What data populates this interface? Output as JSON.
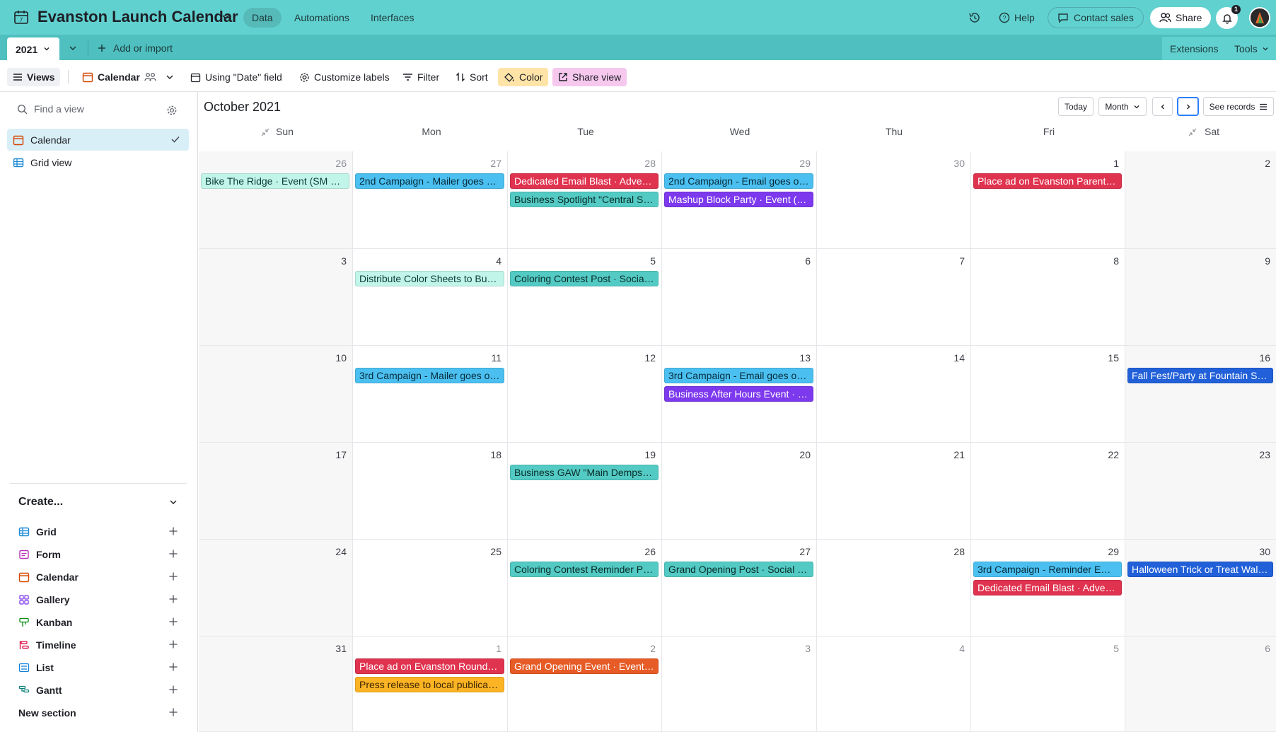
{
  "header": {
    "base_title": "Evanston Launch Calendar",
    "nav": [
      "Data",
      "Automations",
      "Interfaces"
    ],
    "help": "Help",
    "contact_sales": "Contact sales",
    "share": "Share",
    "notification_count": "1"
  },
  "tablebar": {
    "active_table": "2021",
    "add_import": "Add or import",
    "extensions": "Extensions",
    "tools": "Tools"
  },
  "viewbar": {
    "views": "Views",
    "view_name": "Calendar",
    "date_field": "Using \"Date\" field",
    "customize": "Customize labels",
    "filter": "Filter",
    "sort": "Sort",
    "color": "Color",
    "share_view": "Share view"
  },
  "sidebar": {
    "find_placeholder": "Find a view",
    "views": [
      {
        "label": "Calendar",
        "icon": "calendar-icon",
        "active": true
      },
      {
        "label": "Grid view",
        "icon": "grid-icon",
        "active": false
      }
    ],
    "create_heading": "Create...",
    "create_items": [
      "Grid",
      "Form",
      "Calendar",
      "Gallery",
      "Kanban",
      "Timeline",
      "List",
      "Gantt"
    ],
    "new_section": "New section"
  },
  "calendar": {
    "month_label": "October 2021",
    "today": "Today",
    "mode": "Month",
    "see_records": "See records",
    "weekdays": [
      "Sun",
      "Mon",
      "Tue",
      "Wed",
      "Thu",
      "Fri",
      "Sat"
    ],
    "weeks": [
      [
        {
          "day": "26",
          "dim": true,
          "events": [
            {
              "title": "Bike The Ridge · Event (SM Con...",
              "color": "ltcyan"
            }
          ]
        },
        {
          "day": "27",
          "dim": true,
          "events": [
            {
              "title": "2nd Campaign - Mailer goes out...",
              "color": "blue"
            }
          ]
        },
        {
          "day": "28",
          "dim": true,
          "events": [
            {
              "title": "Dedicated Email Blast · Advertis...",
              "color": "red"
            },
            {
              "title": "Business Spotlight \"Central St ...",
              "color": "cyan"
            }
          ]
        },
        {
          "day": "29",
          "dim": true,
          "events": [
            {
              "title": "2nd Campaign - Email goes out...",
              "color": "blue"
            },
            {
              "title": "Mashup Block Party · Event (Ev...",
              "color": "purple"
            }
          ]
        },
        {
          "day": "30",
          "dim": true,
          "events": []
        },
        {
          "day": "1",
          "dim": false,
          "events": [
            {
              "title": "Place ad on Evanston Parent · A...",
              "color": "red"
            }
          ]
        },
        {
          "day": "2",
          "dim": false,
          "events": []
        }
      ],
      [
        {
          "day": "3",
          "dim": false,
          "events": []
        },
        {
          "day": "4",
          "dim": false,
          "events": [
            {
              "title": "Distribute Color Sheets to Busi...",
              "color": "ltcyan"
            }
          ]
        },
        {
          "day": "5",
          "dim": false,
          "events": [
            {
              "title": "Coloring Contest Post · Social ...",
              "color": "cyan"
            }
          ]
        },
        {
          "day": "6",
          "dim": false,
          "events": []
        },
        {
          "day": "7",
          "dim": false,
          "events": []
        },
        {
          "day": "8",
          "dim": false,
          "events": []
        },
        {
          "day": "9",
          "dim": false,
          "events": []
        }
      ],
      [
        {
          "day": "10",
          "dim": false,
          "events": []
        },
        {
          "day": "11",
          "dim": false,
          "events": [
            {
              "title": "3rd Campaign - Mailer goes out...",
              "color": "blue"
            }
          ]
        },
        {
          "day": "12",
          "dim": false,
          "events": []
        },
        {
          "day": "13",
          "dim": false,
          "events": [
            {
              "title": "3rd Campaign - Email goes out...",
              "color": "blue"
            },
            {
              "title": "Business After Hours Event · Ev...",
              "color": "purple"
            }
          ]
        },
        {
          "day": "14",
          "dim": false,
          "events": []
        },
        {
          "day": "15",
          "dim": false,
          "events": []
        },
        {
          "day": "16",
          "dim": false,
          "events": [
            {
              "title": "Fall Fest/Party at Fountain Squa...",
              "color": "royal"
            }
          ]
        }
      ],
      [
        {
          "day": "17",
          "dim": false,
          "events": []
        },
        {
          "day": "18",
          "dim": false,
          "events": []
        },
        {
          "day": "19",
          "dim": false,
          "events": [
            {
              "title": "Business GAW \"Main Dempster...",
              "color": "cyan"
            }
          ]
        },
        {
          "day": "20",
          "dim": false,
          "events": []
        },
        {
          "day": "21",
          "dim": false,
          "events": []
        },
        {
          "day": "22",
          "dim": false,
          "events": []
        },
        {
          "day": "23",
          "dim": false,
          "events": []
        }
      ],
      [
        {
          "day": "24",
          "dim": false,
          "events": []
        },
        {
          "day": "25",
          "dim": false,
          "events": []
        },
        {
          "day": "26",
          "dim": false,
          "events": [
            {
              "title": "Coloring Contest Reminder Pos...",
              "color": "cyan"
            }
          ]
        },
        {
          "day": "27",
          "dim": false,
          "events": [
            {
              "title": "Grand Opening Post · Social Me...",
              "color": "cyan"
            }
          ]
        },
        {
          "day": "28",
          "dim": false,
          "events": []
        },
        {
          "day": "29",
          "dim": false,
          "events": [
            {
              "title": "3rd Campaign - Reminder Email...",
              "color": "blue"
            },
            {
              "title": "Dedicated Email Blast · Advertis...",
              "color": "red"
            }
          ]
        },
        {
          "day": "30",
          "dim": false,
          "events": [
            {
              "title": "Halloween Trick or Treat Walk · ...",
              "color": "royal"
            }
          ]
        }
      ],
      [
        {
          "day": "31",
          "dim": false,
          "events": []
        },
        {
          "day": "1",
          "dim": true,
          "events": [
            {
              "title": "Place ad on Evanston Roundtab...",
              "color": "red"
            },
            {
              "title": "Press release to local publicatio...",
              "color": "yellow"
            }
          ]
        },
        {
          "day": "2",
          "dim": true,
          "events": [
            {
              "title": "Grand Opening Event · Event (F...",
              "color": "orange"
            }
          ]
        },
        {
          "day": "3",
          "dim": true,
          "events": []
        },
        {
          "day": "4",
          "dim": true,
          "events": []
        },
        {
          "day": "5",
          "dim": true,
          "events": []
        },
        {
          "day": "6",
          "dim": true,
          "events": []
        }
      ]
    ]
  },
  "colors": {
    "header_bg": "#61d1d0",
    "tablebar_bg": "#4fbfbf",
    "ltcyan": "#c2f5e9",
    "cyan": "#53cac3",
    "blue": "#4bc0f0",
    "red": "#e0334f",
    "purple": "#7c39ed",
    "royal": "#2160d8",
    "orange": "#e65b26",
    "yellow": "#fcb324"
  }
}
